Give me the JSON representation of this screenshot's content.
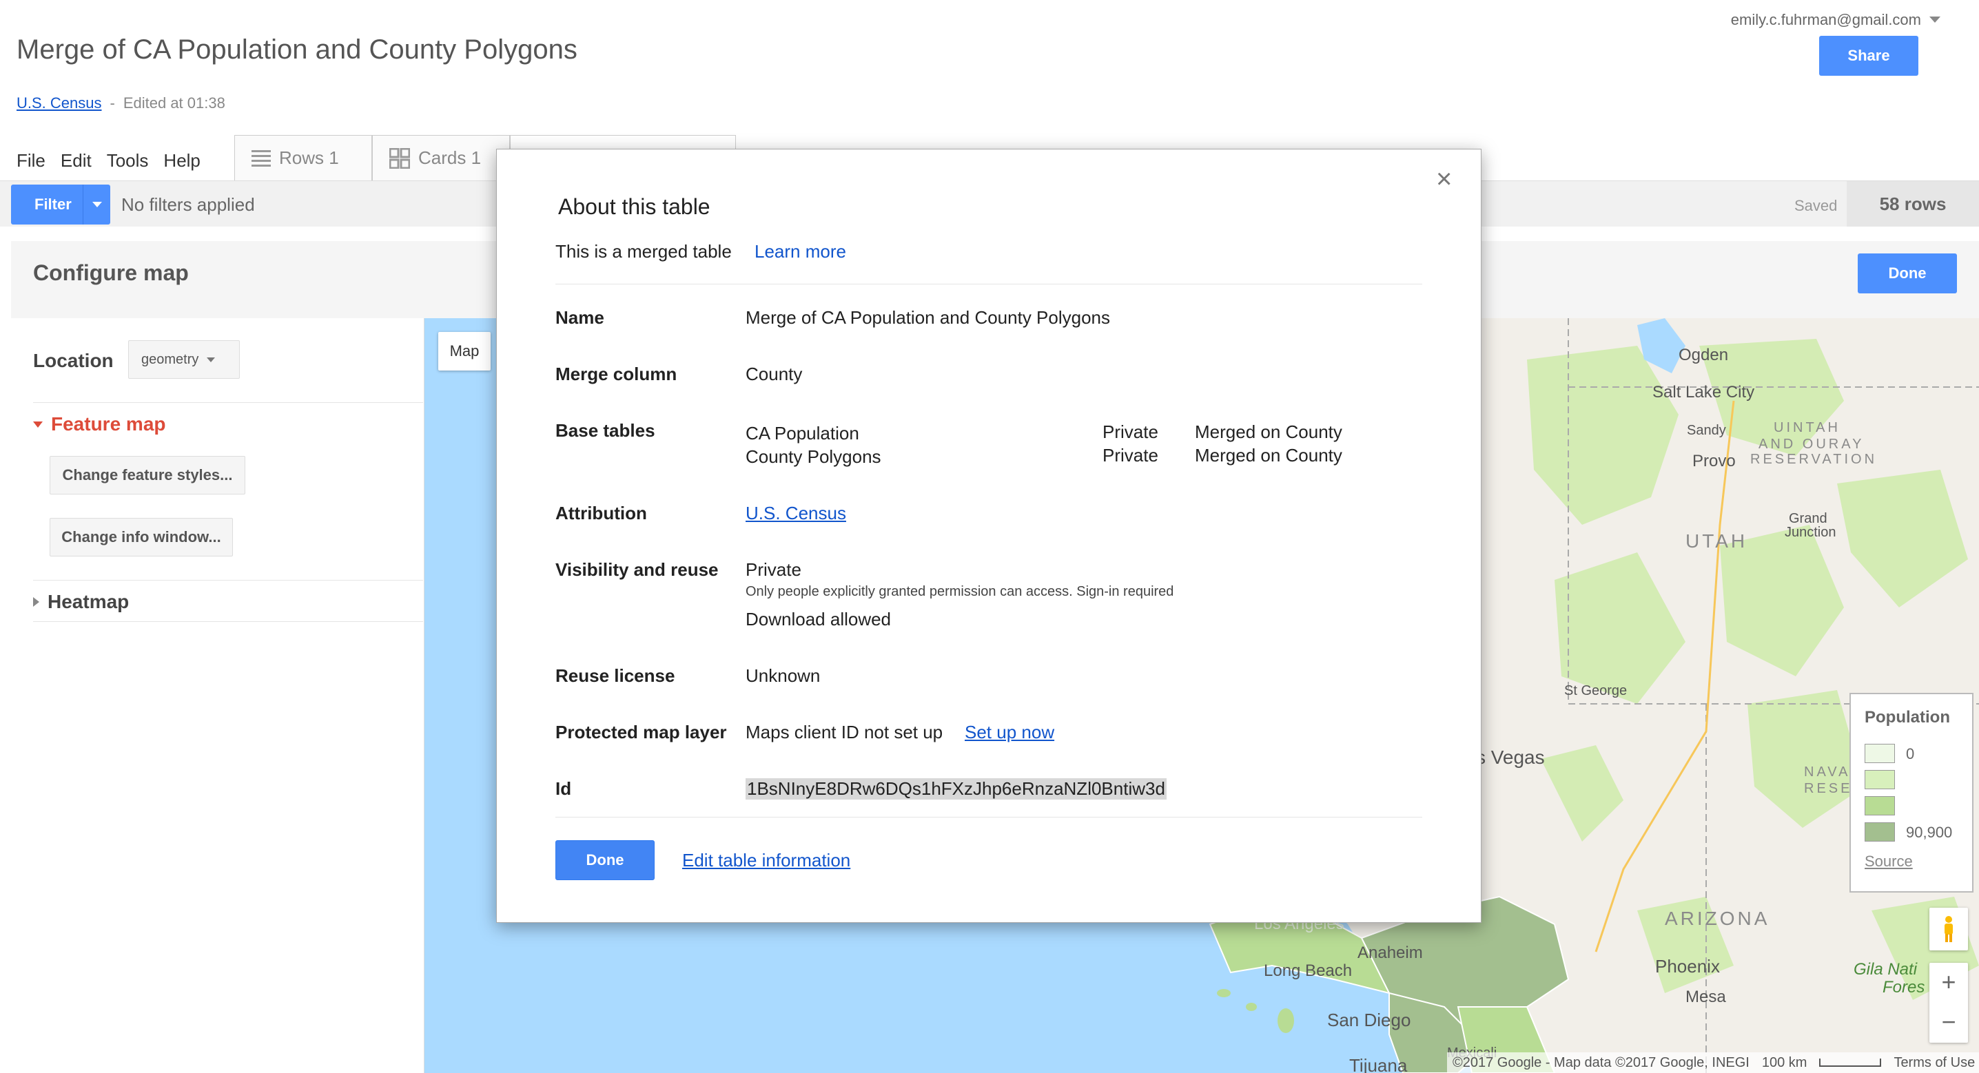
{
  "header": {
    "title": "Merge of CA Population and County Polygons",
    "user_email": "emily.c.fuhrman@gmail.com",
    "share_label": "Share",
    "attribution_link": "U.S. Census",
    "separator": "-",
    "edited": "Edited at 01:38"
  },
  "menu": [
    "File",
    "Edit",
    "Tools",
    "Help"
  ],
  "tabs": [
    {
      "label": "Rows 1"
    },
    {
      "label": "Cards 1"
    }
  ],
  "filter_bar": {
    "filter_label": "Filter",
    "status": "No filters applied",
    "saved": "Saved",
    "row_count": "58 rows"
  },
  "config": {
    "title": "Configure map",
    "done_label": "Done",
    "location_label": "Location",
    "location_value": "geometry",
    "feature_map_label": "Feature map",
    "change_styles_label": "Change feature styles...",
    "change_info_label": "Change info window...",
    "heatmap_label": "Heatmap"
  },
  "map": {
    "map_type_label": "Map",
    "cities": {
      "ogden": "Ogden",
      "salt_lake": "Salt Lake City",
      "sandy": "Sandy",
      "provo": "Provo",
      "grand_junction_1": "Grand",
      "grand_junction_2": "Junction",
      "st_george": "St George",
      "las_vegas": "s Vegas",
      "phoenix": "Phoenix",
      "mesa": "Mesa",
      "anaheim": "Anaheim",
      "los_angeles": "Los Angeles",
      "long_beach": "Long Beach",
      "san_diego": "San Diego",
      "mexicali": "Mexicali",
      "tijuana": "Tijuana"
    },
    "regions": {
      "utah": "UTAH",
      "arizona": "ARIZONA",
      "uintah_1": "UINTAH",
      "uintah_2": "AND OURAY",
      "uintah_3": "RESERVATION",
      "navajo_1": "NAVA",
      "navajo_2": "RESE",
      "gila_1": "Gila Nati",
      "gila_2": "Fores"
    },
    "legend": {
      "title": "Population",
      "items": [
        {
          "label": "0",
          "color": "#eef8e6"
        },
        {
          "label": "",
          "color": "#d8f0bc"
        },
        {
          "label": "",
          "color": "#b8dc94"
        },
        {
          "label": "90,900",
          "color": "#a3bf8f"
        }
      ],
      "source_label": "Source"
    },
    "zoom_in": "+",
    "zoom_out": "−",
    "footer_copyright": "©2017 Google - Map data ©2017 Google, INEGI",
    "footer_scale": "100 km",
    "footer_terms": "Terms of Use"
  },
  "modal": {
    "title": "About this table",
    "subtitle": "This is a merged table",
    "learn_more": "Learn more",
    "close_label": "×",
    "rows": {
      "name_label": "Name",
      "name_value": "Merge of CA Population and County Polygons",
      "merge_label": "Merge column",
      "merge_value": "County",
      "base_label": "Base tables",
      "base_tables": [
        {
          "name": "CA Population",
          "visibility": "Private",
          "merged_on": "Merged on County"
        },
        {
          "name": "County Polygons",
          "visibility": "Private",
          "merged_on": "Merged on County"
        }
      ],
      "attribution_label": "Attribution",
      "attribution_value": "U.S. Census",
      "visibility_label": "Visibility and reuse",
      "visibility_value": "Private",
      "visibility_note": "Only people explicitly granted permission can access. Sign-in required",
      "download_value": "Download allowed",
      "license_label": "Reuse license",
      "license_value": "Unknown",
      "protected_label": "Protected map layer",
      "protected_value": "Maps client ID not set up",
      "setup_link": "Set up now",
      "id_label": "Id",
      "id_value": "1BsNInyE8DRw6DQs1hFXzJhp6eRnzaNZl0Bntiw3d"
    },
    "done_label": "Done",
    "edit_label": "Edit table information"
  },
  "colors": {
    "accent": "#4d90fe",
    "link": "#1155cc",
    "feature_red": "#dd4b39",
    "water": "#aadaff",
    "land": "#f2efe9",
    "park": "#d4ecb4"
  }
}
